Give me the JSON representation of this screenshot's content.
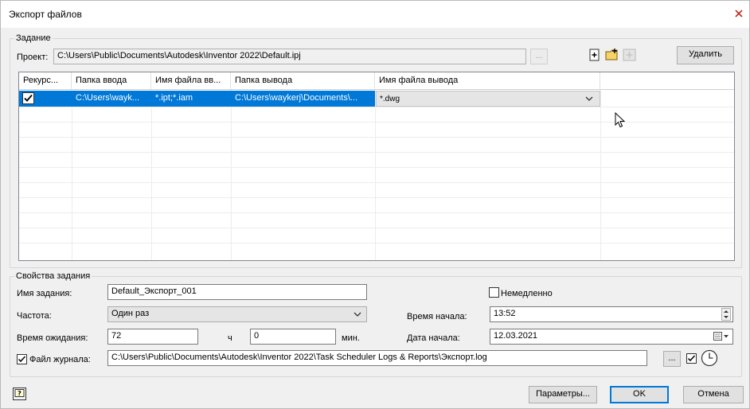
{
  "window": {
    "title": "Экспорт файлов"
  },
  "task_group": {
    "legend": "Задание",
    "project_label": "Проект:",
    "project_path": "C:\\Users\\Public\\Documents\\Autodesk\\Inventor 2022\\Default.ipj",
    "browse_label": "...",
    "delete_label": "Удалить"
  },
  "grid": {
    "columns": [
      "Рекурс...",
      "Папка ввода",
      "Имя файла вв...",
      "Папка вывода",
      "Имя файла вывода"
    ],
    "rows": [
      {
        "recursive_checked": true,
        "input_folder": "C:\\Users\\wayk...",
        "input_filename": "*.ipt;*.iam",
        "output_folder": "C:\\Users\\waykerj\\Documents\\...",
        "output_filename": "*.dwg"
      }
    ]
  },
  "props": {
    "legend": "Свойства задания",
    "task_name_label": "Имя задания:",
    "task_name": "Default_Экспорт_001",
    "frequency_label": "Частота:",
    "frequency": "Один раз",
    "wait_label": "Время ожидания:",
    "wait_hours": "72",
    "hours_unit": "ч",
    "wait_minutes": "0",
    "minutes_unit": "мин.",
    "log_label": "Файл журнала:",
    "log_checked": true,
    "log_path": "C:\\Users\\Public\\Documents\\Autodesk\\Inventor 2022\\Task Scheduler Logs & Reports\\Экспорт.log",
    "log_browse": "...",
    "immediately_label": "Немедленно",
    "immediately_checked": false,
    "start_time_label": "Время начала:",
    "start_time": "13:52",
    "start_date_label": "Дата начала:",
    "start_date": "12.03.2021"
  },
  "footer": {
    "params_label": "Параметры...",
    "ok_label": "OK",
    "cancel_label": "Отмена"
  },
  "colors": {
    "selection": "#0078d7",
    "accent": "#0078d7"
  }
}
